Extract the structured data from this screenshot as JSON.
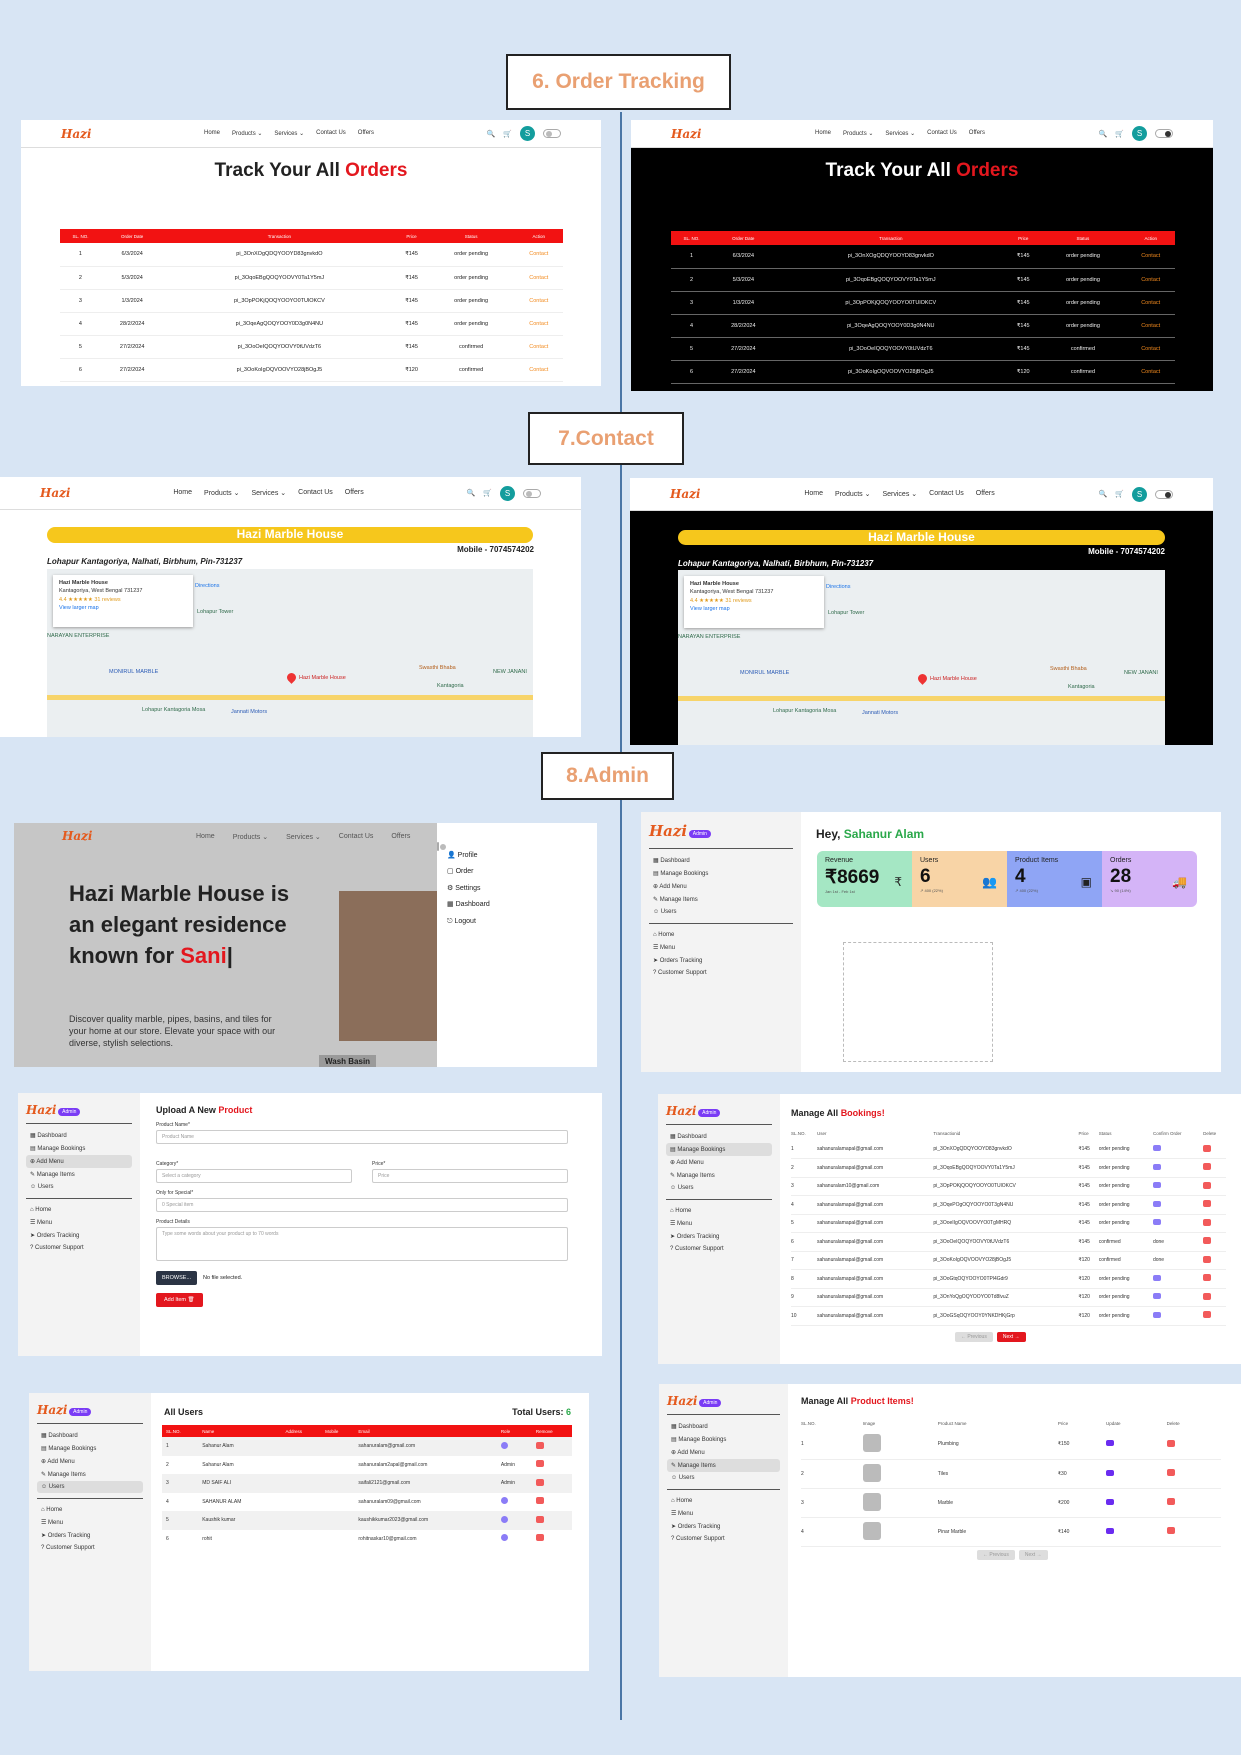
{
  "sections": {
    "order": "6. Order Tracking",
    "contact": "7.Contact",
    "admin": "8.Admin"
  },
  "brand": "Hazi",
  "nav": {
    "links": [
      "Home",
      "Products ⌄",
      "Services ⌄",
      "Contact Us",
      "Offers"
    ],
    "avatar": "S"
  },
  "orders": {
    "title_a": "Track Your All ",
    "title_b": "Orders",
    "headers": [
      "SL. NO.",
      "Order Date",
      "Transaction",
      "Price",
      "Status",
      "Action"
    ],
    "rows": [
      [
        "1",
        "6/3/2024",
        "pi_3OnXOgQDQYOOYD83gnvkdO",
        "₹145",
        "order pending",
        "Contact"
      ],
      [
        "2",
        "5/3/2024",
        "pi_3OqoEBgQOQYOOVY0Ta1Y5mJ",
        "₹145",
        "order pending",
        "Contact"
      ],
      [
        "3",
        "1/3/2024",
        "pi_3OpPOKjQOQYOOYO0TUlOKCV",
        "₹145",
        "order pending",
        "Contact"
      ],
      [
        "4",
        "28/2/2024",
        "pi_3OqeAgQOQYOOY0D3g0N4NU",
        "₹145",
        "order pending",
        "Contact"
      ],
      [
        "5",
        "27/2/2024",
        "pi_3OoOeIQOQYOOVY0tUVdzT6",
        "₹145",
        "confirmed",
        "Contact"
      ],
      [
        "6",
        "27/2/2024",
        "pi_3OoKoIgOQVOOVYO28jBOgJ5",
        "₹120",
        "confirmed",
        "Contact"
      ]
    ]
  },
  "contact": {
    "banner": "Hazi Marble House",
    "address": "Lohapur Kantagoriya, Nalhati, Birbhum, Pin-731237",
    "mobile": "Mobile - 7074574202",
    "map": {
      "card_title": "Hazi Marble House",
      "card_addr": "Kantagoriya, West Bengal 731237",
      "rating": "4.4 ★★★★★  31 reviews",
      "larger": "View larger map",
      "directions": "Directions",
      "places": [
        "Hazi Marble House",
        "Lohapur Tower",
        "MONIRUL MARBLE",
        "Swasthi Bhaba",
        "Lohapur Kantagoria Mosa",
        "Jannati Motors",
        "Kantagoria",
        "NEW JANANI",
        "NARAYAN ENTERPRISE"
      ]
    }
  },
  "admin": {
    "hero": {
      "heading_a": "Hazi Marble House is an elegant residence known for ",
      "heading_b": "Sani",
      "desc": "Discover quality marble, pipes, basins, and tiles for your home at our store. Elevate your space with our diverse, stylish selections.",
      "chip": "Wash Basin",
      "menu": [
        "Profile",
        "Order",
        "Settings",
        "Dashboard",
        "Logout"
      ]
    },
    "badge": "Admin",
    "side_top": [
      "Dashboard",
      "Manage Bookings",
      "Add Menu",
      "Manage Items",
      "Users"
    ],
    "side_bottom": [
      "Home",
      "Menu",
      "Orders Tracking",
      "Customer Support"
    ],
    "dash": {
      "hey": "Hey, ",
      "name": "Sahanur Alam",
      "stats": [
        {
          "label": "Revenue",
          "value": "₹8669",
          "sub": "Jan 1st - Feb 1st",
          "color": "#a5e7c4"
        },
        {
          "label": "Users",
          "value": "6",
          "sub": "↗ 400 (22%)",
          "color": "#f8d4a6"
        },
        {
          "label": "Product Items",
          "value": "4",
          "sub": "↗ 400 (22%)",
          "color": "#8fa5f5"
        },
        {
          "label": "Orders",
          "value": "28",
          "sub": "↘ 90 (14%)",
          "color": "#d4b4f7"
        }
      ]
    },
    "upload": {
      "title_a": "Upload A New ",
      "title_b": "Product",
      "fields": {
        "name": "Product Name*",
        "name_ph": "Product Name",
        "cat": "Category*",
        "cat_ph": "Select a category",
        "price": "Price*",
        "price_ph": "Price",
        "special": "Only for Special*",
        "special_ph": "0 Special item",
        "details": "Product Details",
        "details_ph": "Type some words about your product up to 70 words"
      },
      "browse": "BROWSE...",
      "nofile": "No file selected.",
      "add": "Add Item 🗑"
    },
    "bookings": {
      "title_a": "Manage All ",
      "title_b": "Bookings!",
      "headers": [
        "SL.NO.",
        "User",
        "Transactionid",
        "Price",
        "Status",
        "Confirm Order",
        "Delete"
      ],
      "rows": [
        [
          "1",
          "sahanuralamapal@gmail.com",
          "pi_3OnXOgQDQYOOYD83gnvkdO",
          "₹145",
          "order pending",
          ""
        ],
        [
          "2",
          "sahanuralamapal@gmail.com",
          "pi_3OqoEBgQOQYOOVY0Ta1Y5mJ",
          "₹145",
          "order pending",
          ""
        ],
        [
          "3",
          "sahanuralam10@gmail.com",
          "pi_3OpPOKjQOQYOOYO0TUlOKCV",
          "₹145",
          "order pending",
          ""
        ],
        [
          "4",
          "sahanuralamapal@gmail.com",
          "pi_3OqePOgOQYOOYO0T3gN4NU",
          "₹145",
          "order pending",
          ""
        ],
        [
          "5",
          "sahanuralamapal@gmail.com",
          "pi_3OoeIIgOQVOOVYO0TgMHRQ",
          "₹145",
          "order pending",
          ""
        ],
        [
          "6",
          "sahanuralamapal@gmail.com",
          "pi_3OoOeIQOQYOOVY0tUVdzT6",
          "₹145",
          "confirmed",
          "done"
        ],
        [
          "7",
          "sahanuralamapal@gmail.com",
          "pi_3OoKoIgOQVOOVYO28jBOgJ5",
          "₹120",
          "confirmed",
          "done"
        ],
        [
          "8",
          "sahanuralamapal@gmail.com",
          "pi_3OoGtqOQYOOYO0TPl4Gdr9",
          "₹120",
          "order pending",
          ""
        ],
        [
          "9",
          "sahanuralamapal@gmail.com",
          "pi_3OnYoQgOQYOOYO0Td8lvuZ",
          "₹120",
          "order pending",
          ""
        ],
        [
          "10",
          "sahanuralamapal@gmail.com",
          "pi_3OoGSqOQYOOY0YNKDHKjGrp",
          "₹120",
          "order pending",
          ""
        ]
      ],
      "prev": "← Previous",
      "next": "Next →"
    },
    "users": {
      "title": "All Users",
      "total_label": "Total Users: ",
      "total": "6",
      "headers": [
        "SL.NO.",
        "Name",
        "Address",
        "Mobile",
        "Email",
        "Role",
        "Remove"
      ],
      "rows": [
        [
          "1",
          "Sahanur Alam",
          "",
          "",
          "sahanuralam@gmail.com",
          ""
        ],
        [
          "2",
          "Sahanur Alam",
          "",
          "",
          "sahanuralam2apal@gmail.com",
          "Admin"
        ],
        [
          "3",
          "MD SAIF ALI",
          "",
          "",
          "saifali2121@gmail.com",
          "Admin"
        ],
        [
          "4",
          "SAHANUR ALAM",
          "",
          "",
          "sahanuralam09@gmail.com",
          ""
        ],
        [
          "5",
          "Kaushik kumar",
          "",
          "",
          "kaushikkumar2023@gmail.com",
          ""
        ],
        [
          "6",
          "rohit",
          "",
          "",
          "rohitnaskar10@gmail.com",
          ""
        ]
      ]
    },
    "items": {
      "title_a": "Manage All ",
      "title_b": "Product Items!",
      "headers": [
        "SL.NO.",
        "Image",
        "Product Name",
        "Price",
        "Update",
        "Delete"
      ],
      "rows": [
        [
          "1",
          "Plumbing",
          "₹150"
        ],
        [
          "2",
          "Tiles",
          "₹30"
        ],
        [
          "3",
          "Marble",
          "₹200"
        ],
        [
          "4",
          "Pinar Marble",
          "₹140"
        ]
      ],
      "prev": "← Previous",
      "next": "Next →"
    }
  }
}
